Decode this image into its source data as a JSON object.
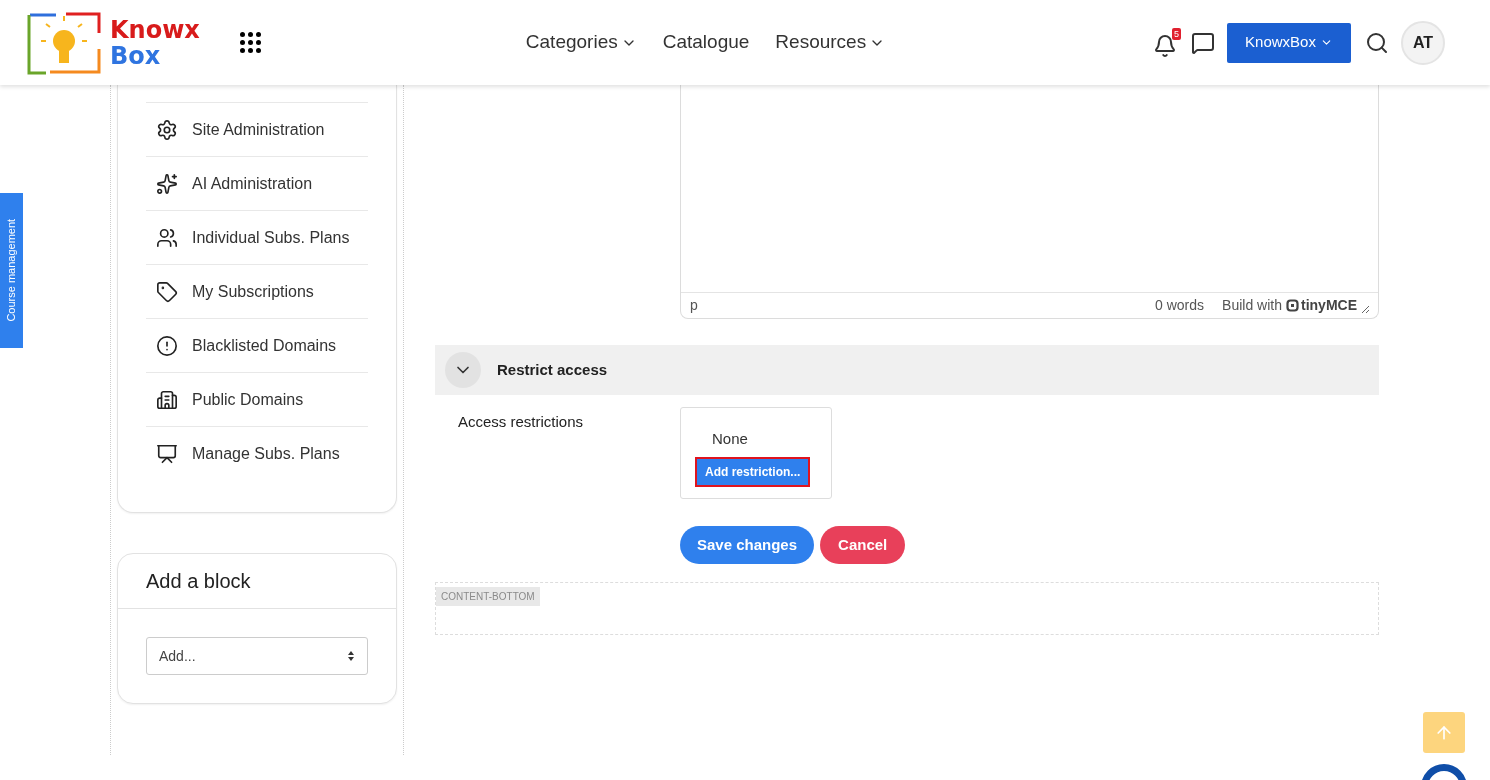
{
  "header": {
    "logo": {
      "line_1": "Knowx",
      "line_2": "Box"
    },
    "nav": [
      {
        "label": "Categories",
        "dropdown": true
      },
      {
        "label": "Catalogue",
        "dropdown": false
      },
      {
        "label": "Resources",
        "dropdown": true
      }
    ],
    "notifications": {
      "count": "5"
    },
    "account_button": {
      "label": "KnowxBox"
    },
    "avatar": {
      "initials": "AT"
    }
  },
  "side_tab": {
    "label": "Course management"
  },
  "sidebar": {
    "items": [
      {
        "label": "Site Administration"
      },
      {
        "label": "AI Administration"
      },
      {
        "label": "Individual Subs. Plans"
      },
      {
        "label": "My Subscriptions"
      },
      {
        "label": "Blacklisted Domains"
      },
      {
        "label": "Public Domains"
      },
      {
        "label": "Manage Subs. Plans"
      }
    ],
    "add_block": {
      "title": "Add a block",
      "select": {
        "value": "Add..."
      }
    }
  },
  "editor": {
    "status": {
      "path": "p",
      "word_count": "0 words",
      "credit": "Build with",
      "brand": "tinyMCE"
    }
  },
  "restrict_access": {
    "title": "Restrict access",
    "expanded": true,
    "label": "Access restrictions",
    "value": "None",
    "add_button": "Add restriction..."
  },
  "buttons": [
    {
      "label": "Save changes",
      "kind": "primary"
    },
    {
      "label": "Cancel",
      "kind": "danger"
    }
  ],
  "region": {
    "label": "CONTENT-BOTTOM"
  }
}
